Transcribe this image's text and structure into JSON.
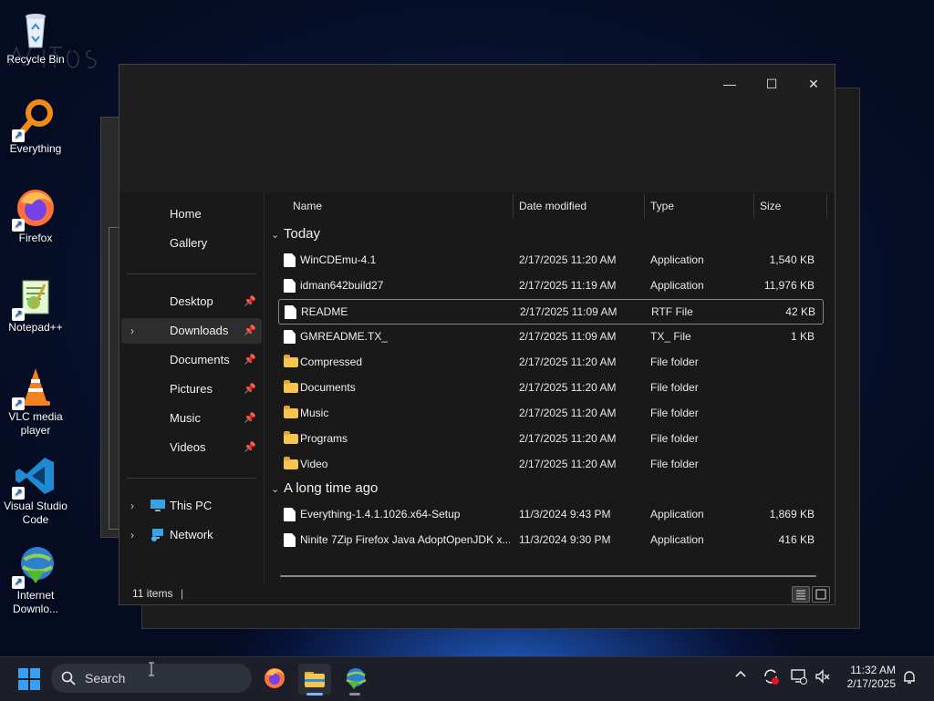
{
  "desktop": {
    "icons": [
      {
        "label": "Recycle Bin",
        "icon": "recycle-bin-icon"
      },
      {
        "label": "Everything",
        "icon": "magnifier-icon"
      },
      {
        "label": "Firefox",
        "icon": "firefox-icon"
      },
      {
        "label": "Notepad++",
        "icon": "notepadpp-icon"
      },
      {
        "label": "VLC media player",
        "icon": "vlc-cone-icon"
      },
      {
        "label": "Visual Studio Code",
        "icon": "vscode-icon"
      },
      {
        "label": "Internet Downlo...",
        "icon": "idm-globe-icon"
      }
    ]
  },
  "explorer": {
    "window_controls": {
      "minimize": "—",
      "maximize": "☐",
      "close": "✕"
    },
    "nav": {
      "home": "Home",
      "gallery": "Gallery",
      "desktop": "Desktop",
      "downloads": "Downloads",
      "documents": "Documents",
      "pictures": "Pictures",
      "music": "Music",
      "videos": "Videos",
      "this_pc": "This PC",
      "network": "Network"
    },
    "columns": {
      "name": "Name",
      "date": "Date modified",
      "type": "Type",
      "size": "Size"
    },
    "groups": {
      "today": "Today",
      "long_ago": "A long time ago"
    },
    "rows_today": [
      {
        "name": "WinCDEmu-4.1",
        "date": "2/17/2025 11:20 AM",
        "type": "Application",
        "size": "1,540 KB",
        "kind": "file"
      },
      {
        "name": "idman642build27",
        "date": "2/17/2025 11:19 AM",
        "type": "Application",
        "size": "11,976 KB",
        "kind": "file"
      },
      {
        "name": "README",
        "date": "2/17/2025 11:09 AM",
        "type": "RTF File",
        "size": "42 KB",
        "kind": "file"
      },
      {
        "name": "GMREADME.TX_",
        "date": "2/17/2025 11:09 AM",
        "type": "TX_ File",
        "size": "1 KB",
        "kind": "file"
      },
      {
        "name": "Compressed",
        "date": "2/17/2025 11:20 AM",
        "type": "File folder",
        "size": "",
        "kind": "folder"
      },
      {
        "name": "Documents",
        "date": "2/17/2025 11:20 AM",
        "type": "File folder",
        "size": "",
        "kind": "folder"
      },
      {
        "name": "Music",
        "date": "2/17/2025 11:20 AM",
        "type": "File folder",
        "size": "",
        "kind": "folder"
      },
      {
        "name": "Programs",
        "date": "2/17/2025 11:20 AM",
        "type": "File folder",
        "size": "",
        "kind": "folder"
      },
      {
        "name": "Video",
        "date": "2/17/2025 11:20 AM",
        "type": "File folder",
        "size": "",
        "kind": "folder"
      }
    ],
    "rows_old": [
      {
        "name": "Everything-1.4.1.1026.x64-Setup",
        "date": "11/3/2024 9:43 PM",
        "type": "Application",
        "size": "1,869 KB",
        "kind": "file"
      },
      {
        "name": "Ninite 7Zip Firefox Java AdoptOpenJDK x...",
        "date": "11/3/2024 9:30 PM",
        "type": "Application",
        "size": "416 KB",
        "kind": "file"
      }
    ],
    "status": {
      "items": "11 items"
    }
  },
  "taskbar": {
    "search_label": "Search",
    "time": "11:32 AM",
    "date": "2/17/2025",
    "accent": "#3b9ef5"
  }
}
